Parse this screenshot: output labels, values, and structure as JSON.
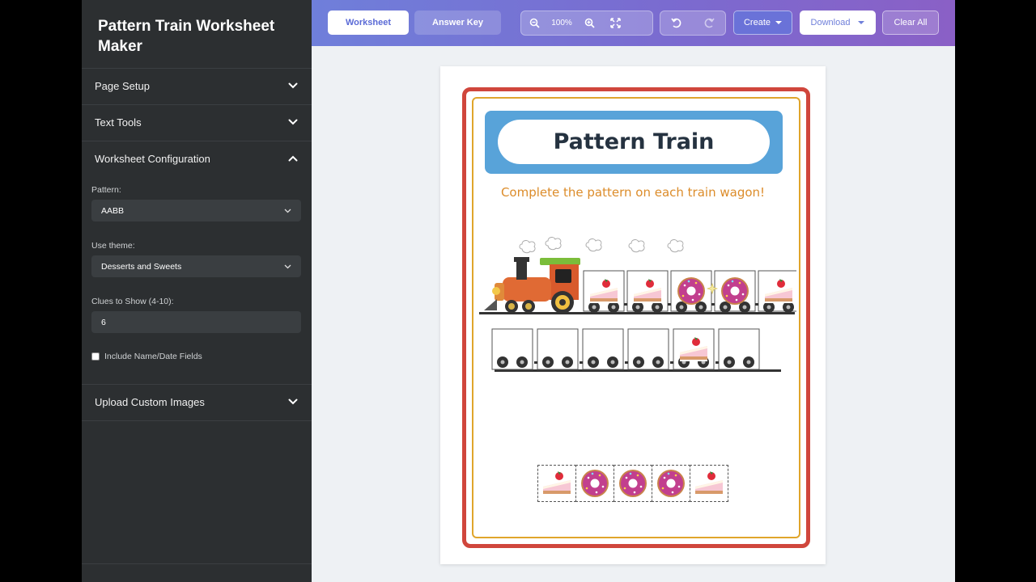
{
  "app_title": "Pattern Train Worksheet Maker",
  "sidebar": {
    "sections": [
      {
        "label": "Page Setup",
        "expanded": false
      },
      {
        "label": "Text Tools",
        "expanded": false
      },
      {
        "label": "Worksheet Configuration",
        "expanded": true
      },
      {
        "label": "Upload Custom Images",
        "expanded": false
      }
    ],
    "config": {
      "pattern_label": "Pattern:",
      "pattern_value": "AABB",
      "theme_label": "Use theme:",
      "theme_value": "Desserts and Sweets",
      "clues_label": "Clues to Show (4-10):",
      "clues_value": "6",
      "name_date_label": "Include Name/Date Fields",
      "name_date_checked": false
    }
  },
  "toolbar": {
    "worksheet_tab": "Worksheet",
    "answer_key_tab": "Answer Key",
    "zoom_level": "100%",
    "create_label": "Create",
    "download_label": "Download",
    "clear_all_label": "Clear All"
  },
  "worksheet": {
    "title": "Pattern Train",
    "subtitle": "Complete the pattern on each train wagon!",
    "row1_wagons": [
      "cake",
      "cake",
      "donut",
      "donut",
      "cake"
    ],
    "row2_wagons": [
      "",
      "",
      "",
      "",
      "cake",
      ""
    ],
    "answer_choices": [
      "cake",
      "donut",
      "donut",
      "donut",
      "cake"
    ]
  },
  "colors": {
    "accent": "#6f7fda",
    "frame_red": "#d0463c",
    "frame_gold": "#e0a52b",
    "title_band": "#58a3d9",
    "subtitle": "#dc8c2a",
    "sidebar_bg": "#2c2f31"
  }
}
